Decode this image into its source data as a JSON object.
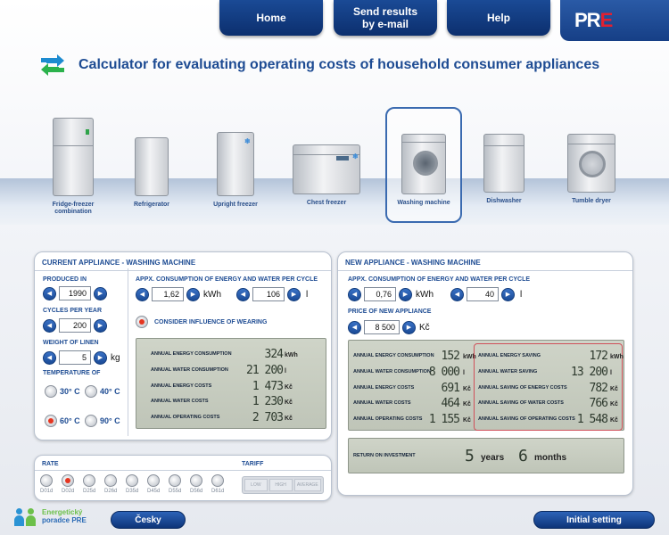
{
  "nav": {
    "home": "Home",
    "send_line1": "Send results",
    "send_line2": "by e-mail",
    "help": "Help"
  },
  "logo": {
    "pr": "PR",
    "e": "E"
  },
  "title": "Calculator for evaluating operating costs of household consumer appliances",
  "appliances": [
    {
      "label_line1": "Fridge-freezer",
      "label_line2": "combination"
    },
    {
      "label_line1": "Refrigerator",
      "label_line2": ""
    },
    {
      "label_line1": "Upright freezer",
      "label_line2": ""
    },
    {
      "label_line1": "Chest freezer",
      "label_line2": ""
    },
    {
      "label_line1": "Washing machine",
      "label_line2": ""
    },
    {
      "label_line1": "Dishwasher",
      "label_line2": ""
    },
    {
      "label_line1": "Tumble dryer",
      "label_line2": ""
    }
  ],
  "current": {
    "title": "CURRENT APPLIANCE - WASHING MACHINE",
    "produced_label": "PRODUCED IN",
    "produced_value": "1990",
    "cycles_label": "CYCLES PER YEAR",
    "cycles_value": "200",
    "weight_label": "WEIGHT OF LINEN",
    "weight_value": "5",
    "weight_unit": "kg",
    "temp_label": "TEMPERATURE OF",
    "temps": [
      "30° C",
      "40° C",
      "60° C",
      "90° C"
    ],
    "consumption_label": "APPX. CONSUMPTION OF ENERGY AND WATER PER CYCLE",
    "energy_value": "1,62",
    "energy_unit": "kWh",
    "water_value": "106",
    "water_unit": "l",
    "wearing_label": "CONSIDER INFLUENCE OF WEARING",
    "lcd": [
      {
        "label": "ANNUAL ENERGY CONSUMPTION",
        "value": "324",
        "unit": "kWh"
      },
      {
        "label": "ANNUAL WATER CONSUMPTION",
        "value": "21 200",
        "unit": "l"
      },
      {
        "label": "ANNUAL ENERGY COSTS",
        "value": "1 473",
        "unit": "Kč"
      },
      {
        "label": "ANNUAL WATER COSTS",
        "value": "1 230",
        "unit": "Kč"
      },
      {
        "label": "ANNUAL OPERATING COSTS",
        "value": "2 703",
        "unit": "Kč"
      }
    ]
  },
  "new": {
    "title": "NEW APPLIANCE - WASHING MACHINE",
    "consumption_label": "APPX. CONSUMPTION OF ENERGY AND WATER PER CYCLE",
    "energy_value": "0,76",
    "energy_unit": "kWh",
    "water_value": "40",
    "water_unit": "l",
    "price_label": "PRICE OF NEW APPLIANCE",
    "price_value": "8 500",
    "price_unit": "Kč",
    "lcd": [
      {
        "label": "ANNUAL ENERGY CONSUMPTION",
        "value": "152",
        "unit": "kWh"
      },
      {
        "label": "ANNUAL WATER CONSUMPTION",
        "value": "8 000",
        "unit": "l"
      },
      {
        "label": "ANNUAL ENERGY COSTS",
        "value": "691",
        "unit": "Kč"
      },
      {
        "label": "ANNUAL WATER COSTS",
        "value": "464",
        "unit": "Kč"
      },
      {
        "label": "ANNUAL OPERATING COSTS",
        "value": "1 155",
        "unit": "Kč"
      }
    ],
    "saving": [
      {
        "label": "ANNUAL ENERGY SAVING",
        "value": "172",
        "unit": "kWh"
      },
      {
        "label": "ANNUAL WATER SAVING",
        "value": "13 200",
        "unit": "l"
      },
      {
        "label": "ANNUAL SAVING OF ENERGY COSTS",
        "value": "782",
        "unit": "Kč"
      },
      {
        "label": "ANNUAL SAVING OF WATER COSTS",
        "value": "766",
        "unit": "Kč"
      },
      {
        "label": "ANNUAL SAVING OF OPERATING COSTS",
        "value": "1 548",
        "unit": "Kč"
      }
    ],
    "roi_label": "RETURN ON INVESTMENT",
    "roi_years": "5",
    "roi_years_unit": "years",
    "roi_months": "6",
    "roi_months_unit": "months"
  },
  "rate": {
    "title": "RATE",
    "tariff_title": "TARIFF",
    "options": [
      "D01d",
      "D02d",
      "D25d",
      "D26d",
      "D35d",
      "D45d",
      "D55d",
      "D56d",
      "D61d"
    ],
    "selected": "D02d",
    "tariffs": [
      "LOW",
      "HIGH",
      "AVERAGE"
    ]
  },
  "footer": {
    "brand_line1": "Energetický",
    "brand_line2": "poradce PRE",
    "language_button": "Česky",
    "reset_button": "Initial setting"
  },
  "colors": {
    "nav": "#163f86",
    "accent_red": "#e22030",
    "title_blue": "#1e4c93"
  }
}
